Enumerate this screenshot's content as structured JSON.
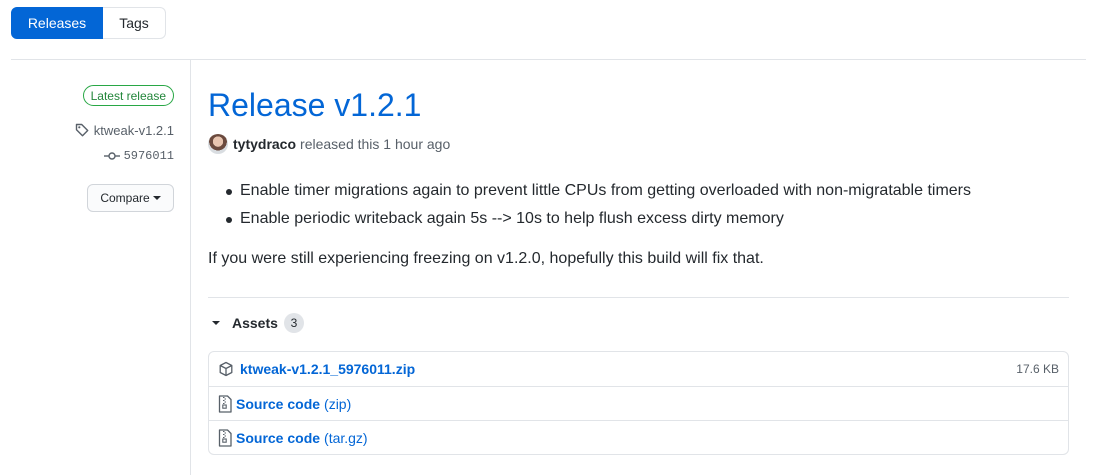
{
  "tabs": [
    {
      "label": "Releases",
      "active": true
    },
    {
      "label": "Tags",
      "active": false
    }
  ],
  "sidebar": {
    "latest_badge": "Latest release",
    "tag": "ktweak-v1.2.1",
    "commit": "5976011",
    "compare_label": "Compare"
  },
  "release": {
    "title": "Release v1.2.1",
    "author": "tytydraco",
    "released_text": "released this 1 hour ago",
    "bullets": [
      "Enable timer migrations again to prevent little CPUs from getting overloaded with non-migratable timers",
      "Enable periodic writeback again 5s --> 10s to help flush excess dirty memory"
    ],
    "paragraph": "If you were still experiencing freezing on v1.2.0, hopefully this build will fix that."
  },
  "assets": {
    "label": "Assets",
    "count": "3",
    "items": [
      {
        "name": "ktweak-v1.2.1_5976011.zip",
        "ext": "",
        "size": "17.6 KB",
        "icon": "package-icon"
      },
      {
        "name": "Source code",
        "ext": "(zip)",
        "size": "",
        "icon": "file-zip-icon"
      },
      {
        "name": "Source code",
        "ext": "(tar.gz)",
        "size": "",
        "icon": "file-zip-icon"
      }
    ]
  },
  "colors": {
    "accent": "#0366d6",
    "success": "#28a745",
    "muted": "#586069",
    "border": "#e1e4e8"
  }
}
